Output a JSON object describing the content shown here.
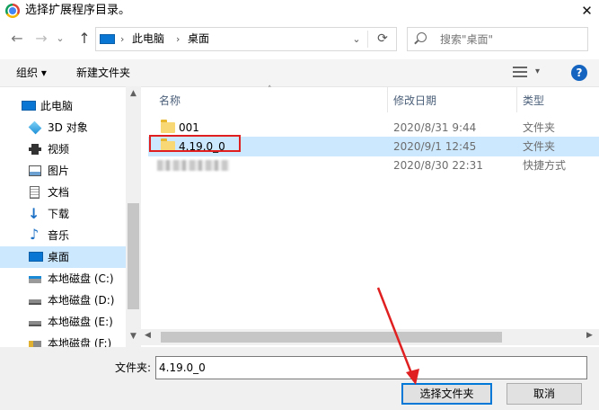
{
  "window": {
    "title": "选择扩展程序目录。",
    "close_glyph": "✕"
  },
  "nav": {
    "back_glyph": "←",
    "forward_glyph": "→",
    "dropdown_glyph": "⌄",
    "up_glyph": "↑",
    "breadcrumb": [
      "此电脑",
      "桌面"
    ],
    "crumb_sep": "›"
  },
  "search": {
    "placeholder": "搜索\"桌面\""
  },
  "toolbar": {
    "organize": "组织 ▾",
    "new_folder": "新建文件夹",
    "help": "?"
  },
  "sidebar": {
    "items": [
      {
        "label": "此电脑",
        "icon": "computer-icon"
      },
      {
        "label": "3D 对象",
        "icon": "cube-3d-icon"
      },
      {
        "label": "视频",
        "icon": "video-icon"
      },
      {
        "label": "图片",
        "icon": "picture-icon"
      },
      {
        "label": "文档",
        "icon": "document-icon"
      },
      {
        "label": "下载",
        "icon": "download-icon"
      },
      {
        "label": "音乐",
        "icon": "music-icon"
      },
      {
        "label": "桌面",
        "icon": "desktop-icon"
      },
      {
        "label": "本地磁盘 (C:)",
        "icon": "windows-drive-icon"
      },
      {
        "label": "本地磁盘 (D:)",
        "icon": "drive-icon"
      },
      {
        "label": "本地磁盘 (E:)",
        "icon": "drive-icon"
      },
      {
        "label": "本地磁盘 (F:)",
        "icon": "drive-lock-icon"
      }
    ]
  },
  "list": {
    "columns": [
      "名称",
      "修改日期",
      "类型"
    ],
    "rows": [
      {
        "name": "001",
        "date": "2020/8/31 9:44",
        "type": "文件夹",
        "icon": "folder-icon"
      },
      {
        "name": "4.19.0_0",
        "date": "2020/9/1 12:45",
        "type": "文件夹",
        "icon": "folder-icon"
      },
      {
        "name": "",
        "date": "2020/8/30 22:31",
        "type": "快捷方式",
        "icon": "blurred-shortcut-icon"
      }
    ]
  },
  "bottom": {
    "filename_label": "文件夹:",
    "filename_value": "4.19.0_0",
    "ok_label": "选择文件夹",
    "cancel_label": "取消"
  },
  "colors": {
    "selection": "#cce8ff",
    "annotation": "#e02020",
    "accent": "#0078d7"
  }
}
